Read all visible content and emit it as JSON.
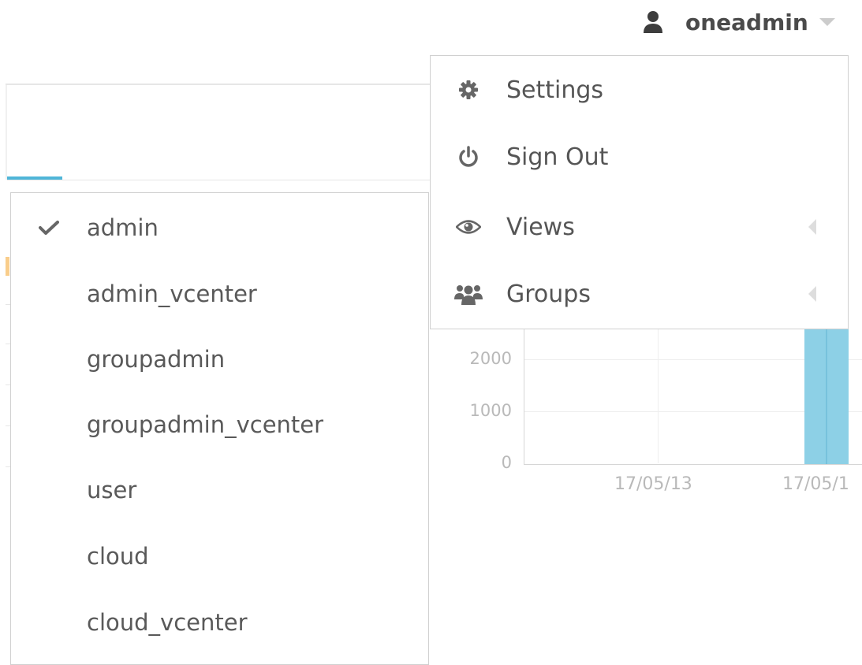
{
  "header": {
    "user_name": "oneadmin",
    "user_icon": "user-icon",
    "caret_icon": "caret-down-icon"
  },
  "user_menu": {
    "items": [
      {
        "label": "Settings",
        "icon": "gear-icon"
      },
      {
        "label": "Sign Out",
        "icon": "power-icon"
      },
      {
        "label": "Views",
        "icon": "eye-icon",
        "submenu": true
      },
      {
        "label": "Groups",
        "icon": "users-icon",
        "submenu": true
      }
    ]
  },
  "views_menu": {
    "items": [
      {
        "label": "admin",
        "checked": true
      },
      {
        "label": "admin_vcenter",
        "checked": false
      },
      {
        "label": "groupadmin",
        "checked": false
      },
      {
        "label": "groupadmin_vcenter",
        "checked": false
      },
      {
        "label": "user",
        "checked": false
      },
      {
        "label": "cloud",
        "checked": false
      },
      {
        "label": "cloud_vcenter",
        "checked": false
      }
    ]
  },
  "chart_data": {
    "type": "bar",
    "y_ticks": [
      "0",
      "1000",
      "2000"
    ],
    "x_ticks": [
      "17/05/13",
      "17/05/1"
    ],
    "ylim": [
      0,
      2500
    ],
    "bar_color": "#8dd0e6"
  },
  "colors": {
    "accent": "#4fb5d8",
    "text": "#555555",
    "border": "#d0d0d0"
  }
}
